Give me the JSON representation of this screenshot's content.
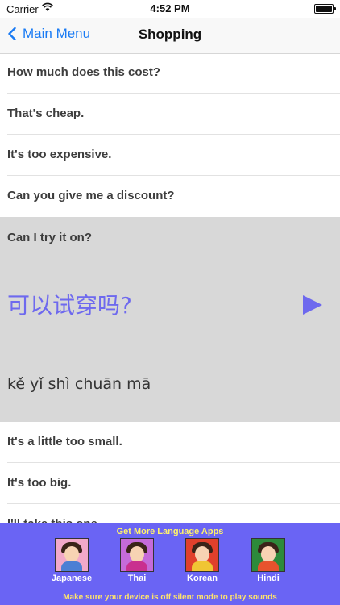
{
  "status_bar": {
    "carrier": "Carrier",
    "time": "4:52 PM"
  },
  "nav": {
    "back_label": "Main Menu",
    "title": "Shopping"
  },
  "phrases_top": [
    "How much does this cost?",
    "That's cheap.",
    "It's too expensive.",
    "Can you give me a discount?"
  ],
  "expanded": {
    "english": "Can I try it on?",
    "chinese": "可以试穿吗?",
    "pinyin": "kě yǐ shì chuān mā"
  },
  "phrases_bottom": [
    "It's a little too small.",
    "It's too big.",
    "I'll take this one."
  ],
  "footer": {
    "promo": "Get More Language Apps",
    "apps": [
      {
        "name": "Japanese",
        "bg": "#f2a9c9",
        "outfit": "#4b7fd4"
      },
      {
        "name": "Thai",
        "bg": "#c56bd9",
        "outfit": "#c9308f"
      },
      {
        "name": "Korean",
        "bg": "#e0402c",
        "outfit": "#f0c534"
      },
      {
        "name": "Hindi",
        "bg": "#2d8a3b",
        "outfit": "#e7532d"
      }
    ],
    "note": "Make sure your device is off silent mode to play sounds"
  },
  "colors": {
    "accent": "#1a7bf4",
    "chinese_text": "#6e69ee",
    "footer_bg": "#6a64f4",
    "promo_text": "#fff36b"
  }
}
